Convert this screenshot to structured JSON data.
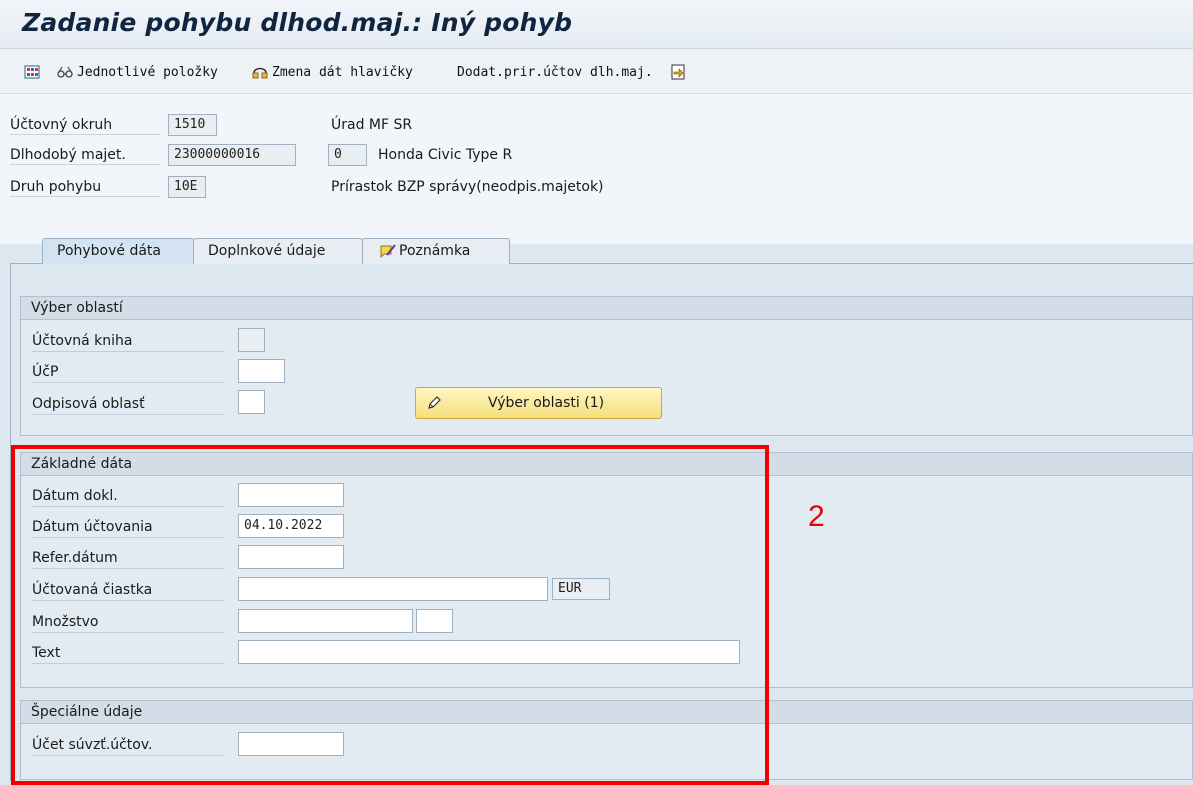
{
  "window": {
    "title": "Zadanie pohybu dlhod.maj.: Iný pohyb"
  },
  "toolbar": {
    "single_items": "Jednotlivé položky",
    "change_header": "Zmena dát hlavičky",
    "supplement": "Dodat.prir.účtov dlh.maj."
  },
  "header": {
    "company_code_label": "Účtovný okruh",
    "company_code": "1510",
    "company_code_desc": "Úrad MF SR",
    "asset_label": "Dlhodobý majet.",
    "asset": "23000000016",
    "sub_number": "0",
    "asset_desc": "Honda Civic Type R",
    "trans_type_label": "Druh pohybu",
    "trans_type": "10E",
    "trans_type_desc": "Prírastok BZP správy(neodpis.majetok)"
  },
  "tabs": [
    {
      "label": "Pohybové dáta"
    },
    {
      "label": "Doplnkové údaje"
    },
    {
      "label": "Poznámka"
    }
  ],
  "area_selection": {
    "title": "Výber oblastí",
    "ledger_label": "Účtovná kniha",
    "ucp_label": "ÚčP",
    "dep_area_label": "Odpisová oblasť",
    "button_label": "Výber oblasti (1)"
  },
  "basic_data": {
    "title": "Základné dáta",
    "doc_date_label": "Dátum dokl.",
    "doc_date": "",
    "posting_date_label": "Dátum účtovania",
    "posting_date": "04.10.2022",
    "ref_date_label": "Refer.dátum",
    "ref_date": "",
    "amount_label": "Účtovaná čiastka",
    "amount": "",
    "currency": "EUR",
    "quantity_label": "Množstvo",
    "text_label": "Text"
  },
  "special_data": {
    "title": "Špeciálne údaje",
    "offset_account_label": "Účet súvzť.účtov."
  },
  "annotation": {
    "number": "2",
    "color": "#ee0000"
  }
}
